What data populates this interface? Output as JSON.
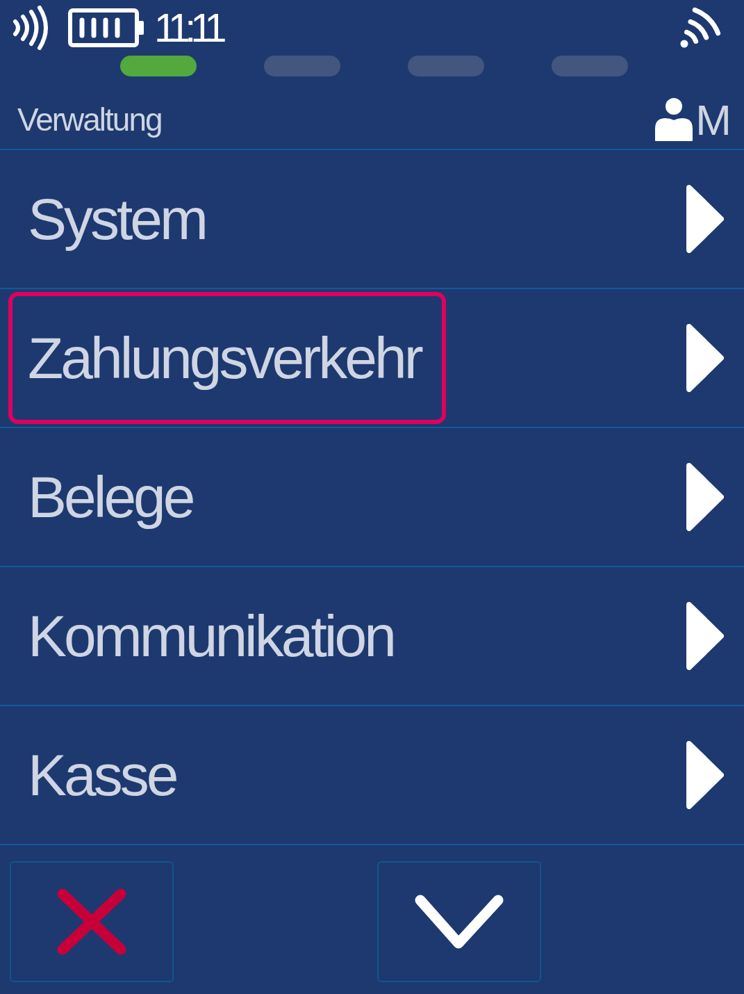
{
  "status_bar": {
    "time": "11:11"
  },
  "pager": [
    {
      "selected": true
    },
    {
      "selected": false
    },
    {
      "selected": false
    },
    {
      "selected": false
    }
  ],
  "header": {
    "title": "Verwaltung",
    "user": "M"
  },
  "menu": [
    {
      "label": "System",
      "selected": false
    },
    {
      "label": "Zahlungsverkehr",
      "selected": true
    },
    {
      "label": "Belege",
      "selected": false
    },
    {
      "label": "Kommunikation",
      "selected": false
    },
    {
      "label": "Kasse",
      "selected": false
    }
  ],
  "buttons": [
    {
      "kind": "cancel"
    },
    {
      "kind": "confirm"
    }
  ]
}
